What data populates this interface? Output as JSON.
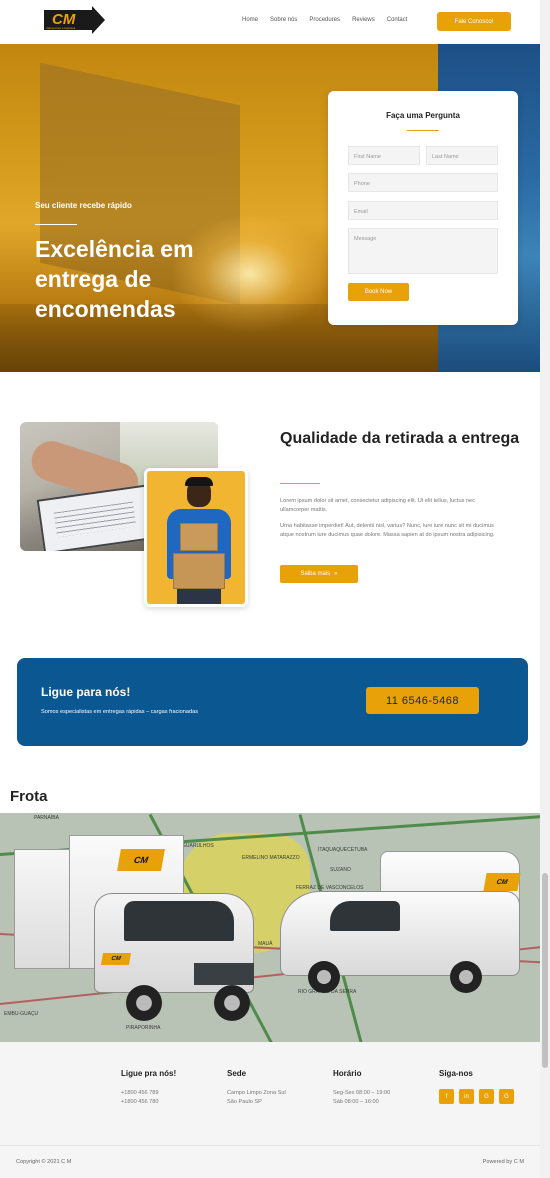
{
  "header": {
    "brand": "CM",
    "brand_tagline": "transportes e logística",
    "nav": [
      "Home",
      "Sobre nós",
      "Procedures",
      "Reviews",
      "Contact"
    ],
    "cta_label": "Fale Conosco!"
  },
  "hero": {
    "kicker": "Seu cliente recebe rápido",
    "title": "Excelência em entrega de encomendas"
  },
  "form": {
    "title": "Faça uma Pergunta",
    "first_name_placeholder": "First Name",
    "last_name_placeholder": "Last Name",
    "phone_placeholder": "Phone",
    "email_placeholder": "Email",
    "message_placeholder": "Message",
    "submit_label": "Book Now"
  },
  "quality": {
    "title": "Qualidade da retirada a entrega",
    "p1": "Lorem ipsum dolor sit amet, consectetur adipiscing elit. Ut elit tellus, luctus nec ullamcorper mattis.",
    "p2": "Urna habitasse imperdiet! Aut, deleniti nisl, varius? Nunc, iure iure nunc sit mi ducimus atque nostrum iure ducimus quae dolore. Massa sapien at do ipsum nostra adipisicing.",
    "button_label": "Saiba mais",
    "button_icon": "»"
  },
  "cta": {
    "title": "Ligue para nós!",
    "subtitle": "Somos especialistas em entregas rápidas – cargas fracionadas",
    "phone": "11 6546-5468"
  },
  "fleet": {
    "title": "Frota",
    "map_labels": [
      "PARNAÍBA",
      "GUARULHOS",
      "ERMELINO MATARAZZO",
      "ITAQUAQUECETUBA",
      "SUZANO",
      "FERRAZ DE VASCONCELOS",
      "MAUÁ",
      "RIO GRANDE DA SERRA",
      "PIRAPORINHA",
      "EMBU-GUAÇU"
    ]
  },
  "footer": {
    "col1_title": "Ligue pra nós!",
    "col1_lines": [
      "+1800 456 789",
      "+1800 456 780"
    ],
    "col2_title": "Sede",
    "col2_lines": [
      "Campo Limpo Zona Sul",
      "São Paulo SP"
    ],
    "col3_title": "Horário",
    "col3_lines": [
      "Seg-Sex 08:00 – 19:00",
      "Sáb 08:00 – 16:00"
    ],
    "col4_title": "Siga-nos",
    "social_icons": [
      "facebook-icon",
      "linkedin-icon",
      "google-plus-icon",
      "google-plus-icon-2"
    ],
    "social_glyphs": [
      "f",
      "in",
      "G",
      "G"
    ],
    "copyright": "Copyright © 2021 C M",
    "powered": "Powered by C M"
  },
  "colors": {
    "accent": "#e8a109",
    "brand_blue": "#0b5791"
  }
}
